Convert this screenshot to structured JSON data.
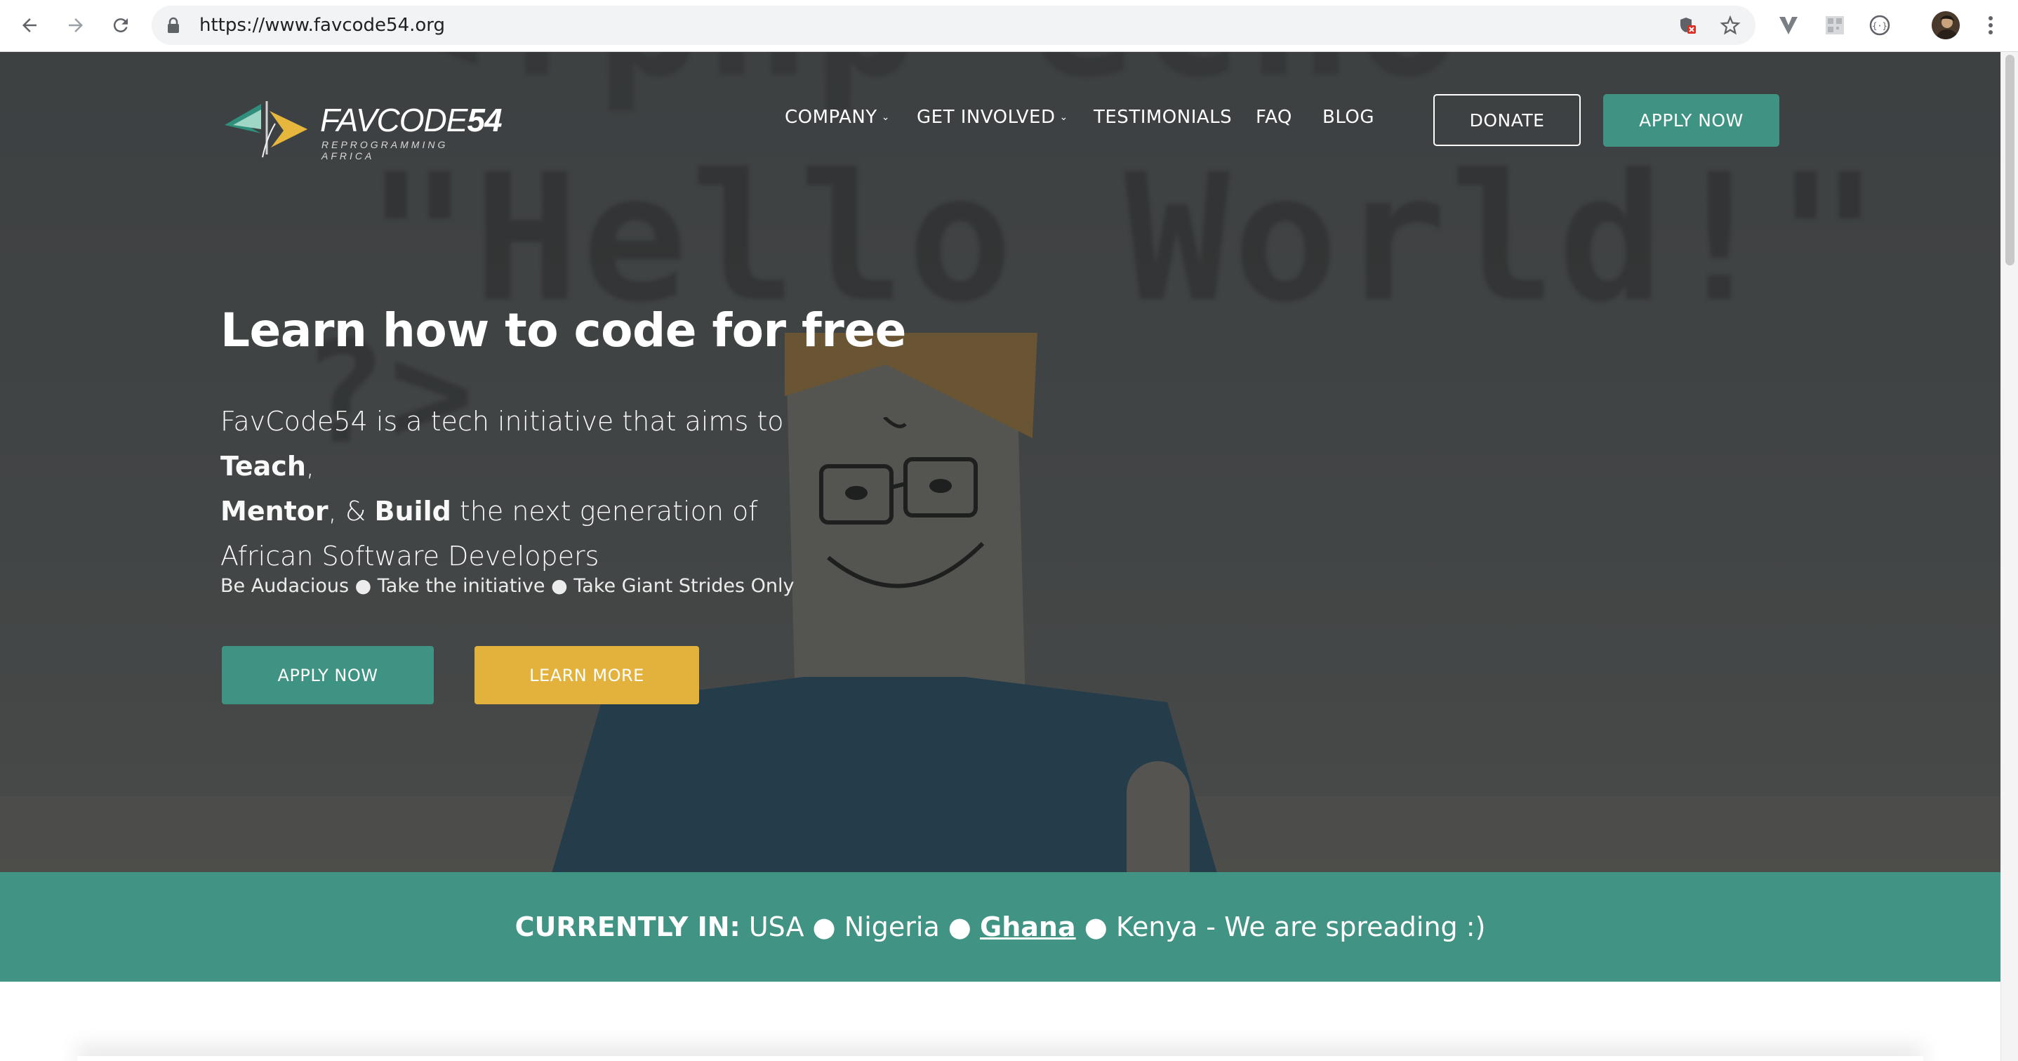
{
  "browser": {
    "url": "https://www.favcode54.org",
    "icons": [
      "back-arrow-icon",
      "forward-arrow-icon",
      "reload-icon",
      "lock-icon",
      "blocked-content-icon",
      "bookmark-star-icon",
      "vivaldi-extension-icon",
      "qr-extension-icon",
      "code-extension-icon",
      "profile-avatar",
      "menu-dots-icon"
    ]
  },
  "site": {
    "logo": {
      "name_main": "FAVCODE",
      "name_num": "54",
      "tagline": "REPROGRAMMING AFRICA"
    },
    "nav": {
      "items": [
        {
          "label": "COMPANY",
          "has_dropdown": true
        },
        {
          "label": "GET INVOLVED",
          "has_dropdown": true
        },
        {
          "label": "TESTIMONIALS",
          "has_dropdown": false
        },
        {
          "label": "FAQ",
          "has_dropdown": false
        },
        {
          "label": "BLOG",
          "has_dropdown": false
        }
      ],
      "donate_label": "DONATE",
      "apply_label": "APPLY NOW"
    },
    "hero": {
      "title": "Learn how to code for free",
      "desc_1": "FavCode54 is a tech initiative that aims to ",
      "desc_teach": "Teach",
      "desc_2": ",",
      "desc_mentor": "Mentor",
      "desc_3": ", & ",
      "desc_build": "Build",
      "desc_4": " the next generation of African Software Developers",
      "tagline": "Be Audacious ● Take the initiative ● Take Giant Strides Only",
      "apply_label": "APPLY NOW",
      "learn_label": "LEARN MORE",
      "background_code_line1": "\"Hello World!\"",
      "background_code_line2": "?>"
    },
    "banner": {
      "label": "CURRENTLY IN:",
      "countries_1": " USA ● Nigeria ● ",
      "link_country": "Ghana",
      "countries_2": " ● Kenya - We are spreading :)"
    }
  },
  "colors": {
    "teal": "#3f9382",
    "gold": "#e3b23c",
    "white": "#ffffff"
  }
}
